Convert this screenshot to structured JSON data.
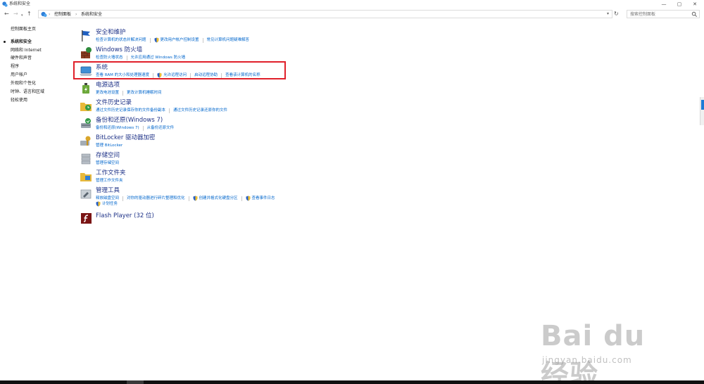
{
  "window": {
    "title": "系统和安全"
  },
  "window_controls": {
    "minimize": "—",
    "maximize": "▢",
    "close": "✕"
  },
  "navigation": {
    "back": "←",
    "forward": "→",
    "recent": "▾",
    "up": "↑",
    "dropdown": "▾",
    "refresh": "↻"
  },
  "address_bar": {
    "crumbs": [
      "控制面板",
      "系统和安全"
    ],
    "separator": "›"
  },
  "search": {
    "placeholder": "搜索控制面板"
  },
  "sidebar": {
    "items": [
      {
        "label": "控制面板主页",
        "active": false
      },
      {
        "label": "系统和安全",
        "active": true
      },
      {
        "label": "网络和 Internet",
        "active": false
      },
      {
        "label": "硬件和声音",
        "active": false
      },
      {
        "label": "程序",
        "active": false
      },
      {
        "label": "用户帐户",
        "active": false
      },
      {
        "label": "外观和个性化",
        "active": false
      },
      {
        "label": "时钟、语言和区域",
        "active": false
      },
      {
        "label": "轻松使用",
        "active": false
      }
    ]
  },
  "categories": [
    {
      "title": "安全和维护",
      "links": [
        "检查计算机的状态并解决问题",
        "更改用户帐户控制设置",
        "常见计算机问题疑难解答"
      ],
      "icon": "flag-icon"
    },
    {
      "title": "Windows 防火墙",
      "links": [
        "检查防火墙状态",
        "允许应用通过 Windows 防火墙"
      ],
      "icon": "firewall-icon"
    },
    {
      "title": "系统",
      "links": [
        "查看 RAM 的大小和处理器速度",
        "允许远程访问",
        "启动远程协助",
        "查看该计算机的名称"
      ],
      "icon": "system-laptop-icon"
    },
    {
      "title": "电源选项",
      "links": [
        "更改电池设置",
        "更改计算机睡眠时间"
      ],
      "icon": "power-icon"
    },
    {
      "title": "文件历史记录",
      "links": [
        "通过文件历史记录保存你的文件备份副本",
        "通过文件历史记录还原你的文件"
      ],
      "icon": "file-history-icon"
    },
    {
      "title": "备份和还原(Windows 7)",
      "links": [
        "备份和还原(Windows 7)",
        "从备份还原文件"
      ],
      "icon": "backup-icon"
    },
    {
      "title": "BitLocker 驱动器加密",
      "links": [
        "管理 BitLocker"
      ],
      "icon": "bitlocker-key-icon"
    },
    {
      "title": "存储空间",
      "links": [
        "管理存储空间"
      ],
      "icon": "storage-icon"
    },
    {
      "title": "工作文件夹",
      "links": [
        "管理工作文件夹"
      ],
      "icon": "work-folder-icon"
    },
    {
      "title": "管理工具",
      "links": [
        "释放磁盘空间",
        "对你的驱动器进行碎片整理和优化",
        "创建并格式化硬盘分区",
        "查看事件日志",
        "计划任务"
      ],
      "icon": "admin-tools-icon"
    },
    {
      "title": "Flash Player (32 位)",
      "links": [],
      "icon": "flash-player-icon"
    }
  ],
  "watermark": {
    "text": "Bai du 经验",
    "sub": "jingyan.baidu.com"
  },
  "colors": {
    "accent": "#1e3287",
    "link": "#0066cc",
    "highlight": "#e0202a"
  }
}
